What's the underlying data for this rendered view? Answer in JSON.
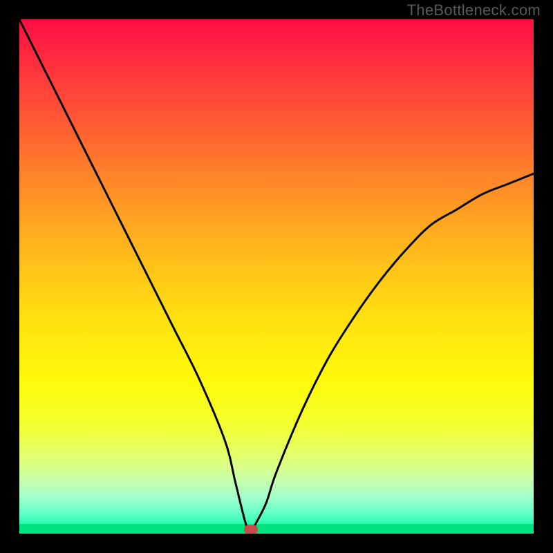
{
  "watermark": "TheBottleneck.com",
  "chart_data": {
    "type": "line",
    "title": "",
    "xlabel": "",
    "ylabel": "",
    "xlim": [
      0,
      100
    ],
    "ylim": [
      0,
      100
    ],
    "grid": false,
    "legend": false,
    "series": [
      {
        "name": "bottleneck-curve",
        "x": [
          0,
          5,
          10,
          15,
          20,
          25,
          30,
          35,
          40,
          42,
          44,
          45,
          46,
          48,
          50,
          55,
          60,
          65,
          70,
          75,
          80,
          85,
          90,
          95,
          100
        ],
        "y": [
          100,
          90,
          80,
          70,
          60,
          50,
          40,
          30,
          18,
          10,
          2,
          0,
          2,
          6,
          12,
          24,
          34,
          42,
          49,
          55,
          60,
          63,
          66,
          68,
          70
        ]
      }
    ],
    "marker": {
      "x": 45,
      "y": 0,
      "color": "#c94b4b"
    },
    "background_gradient": {
      "top": "#ff0e44",
      "middle": "#fff90a",
      "bottom": "#00e884"
    }
  }
}
